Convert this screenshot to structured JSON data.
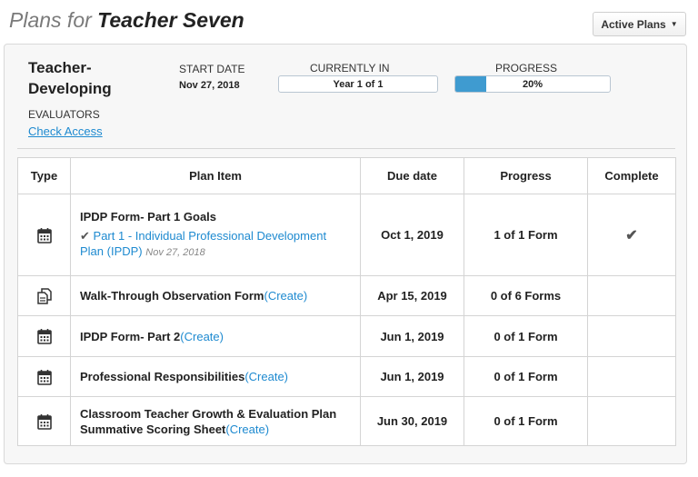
{
  "header": {
    "title_prefix": "Plans for",
    "teacher_name": "Teacher Seven",
    "active_plans_label": "Active Plans"
  },
  "plan": {
    "track_label": "Teacher-Developing",
    "start_date_label": "START DATE",
    "start_date": "Nov 27, 2018",
    "currently_in_label": "CURRENTLY IN",
    "currently_in": "Year 1 of 1",
    "progress_label": "PROGRESS",
    "progress_text": "20%",
    "progress_fraction": 0.2,
    "evaluators_label": "EVALUATORS",
    "check_access_label": "Check Access"
  },
  "table": {
    "headers": [
      "Type",
      "Plan Item",
      "Due date",
      "Progress",
      "Complete"
    ],
    "rows": [
      {
        "icon": "calendar-icon",
        "item": "IPDP Form- Part 1 Goals",
        "sub_link": "Part 1 - Individual Professional Development Plan (IPDP)",
        "sub_date": "Nov 27, 2018",
        "due": "Oct 1, 2019",
        "progress": "1 of 1 Form",
        "complete": true
      },
      {
        "icon": "copy-forms-icon",
        "item": "Walk-Through Observation Form",
        "create": "(Create)",
        "due": "Apr 15, 2019",
        "progress": "0 of 6 Forms"
      },
      {
        "icon": "calendar-icon",
        "item": "IPDP Form- Part 2",
        "create": "(Create)",
        "due": "Jun 1, 2019",
        "progress": "0 of 1 Form"
      },
      {
        "icon": "calendar-icon",
        "item": "Professional Responsibilities",
        "create": "(Create)",
        "due": "Jun 1, 2019",
        "progress": "0 of 1 Form"
      },
      {
        "icon": "calendar-icon",
        "item": "Classroom Teacher Growth & Evaluation Plan Summative Scoring Sheet",
        "create": "(Create)",
        "due": "Jun 30, 2019",
        "progress": "0 of 1 Form"
      }
    ]
  }
}
